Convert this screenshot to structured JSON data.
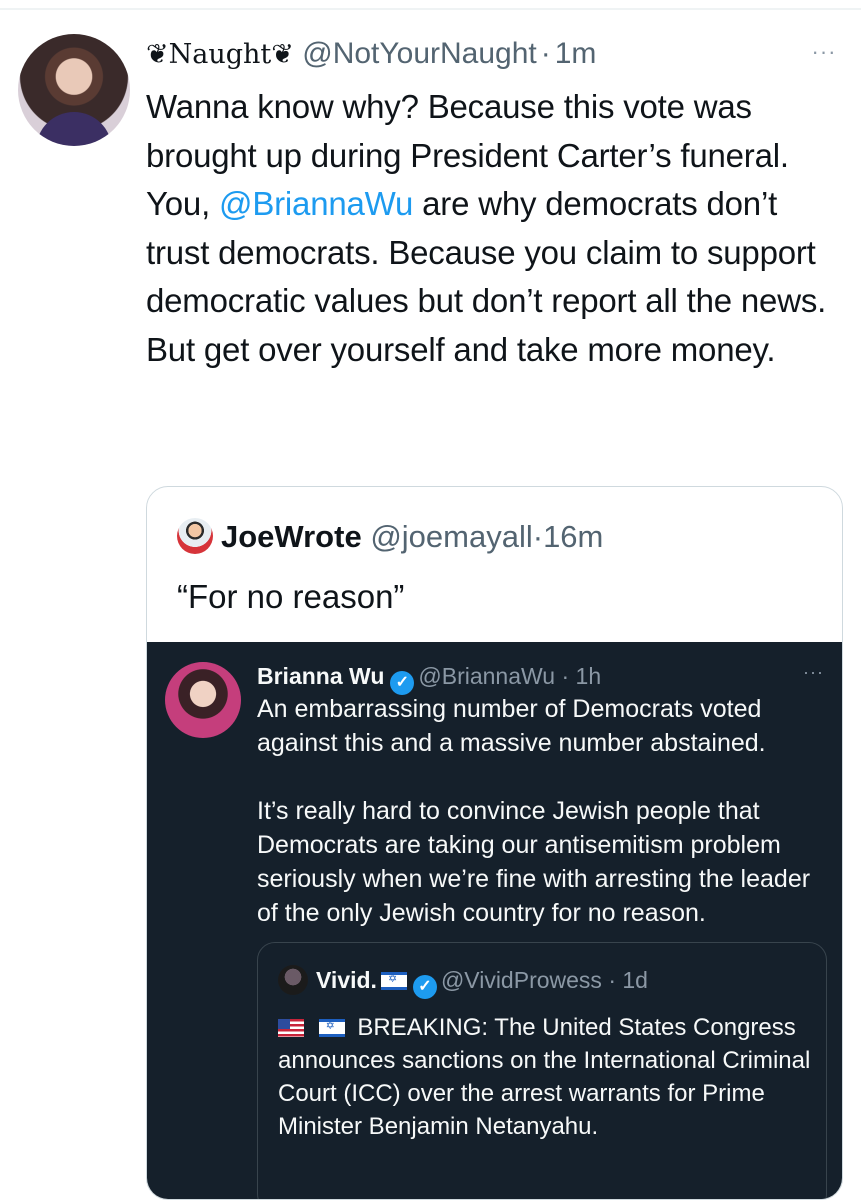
{
  "tweet": {
    "display_name": "❦Naught❦",
    "handle": "@NotYourNaught",
    "separator": "·",
    "time": "1m",
    "more_label": "···",
    "text_before_mention": "Wanna know why? Because this vote was brought up during President Carter’s funeral. You, ",
    "mention": "@BriannaWu",
    "text_after_mention": " are why democrats don’t trust democrats. Because you claim to support democratic values but don’t report all the news. But get over yourself and take more money."
  },
  "quote": {
    "display_name": "JoeWrote",
    "handle": "@joemayall",
    "separator": "·",
    "time": "16m",
    "text": "“For no reason”"
  },
  "screenshot": {
    "display_name": "Brianna Wu",
    "verified_mark": "✓",
    "handle": "@BriannaWu",
    "separator": "·",
    "time": "1h",
    "more_label": "···",
    "paragraph_1": "An embarrassing number of Democrats voted against this and a massive number abstained.",
    "paragraph_2": "It’s really hard to convince Jewish people that Democrats are taking our antisemitism problem seriously when we’re fine with arresting the leader of the only Jewish country for no reason."
  },
  "inner_quote": {
    "display_name": "Vivid.",
    "verified_mark": "✓",
    "handle": "@VividProwess",
    "separator": "·",
    "time": "1d",
    "text": "BREAKING: The United States Congress announces sanctions on the International Criminal Court (ICC) over the arrest warrants for Prime Minister Benjamin Netanyahu."
  },
  "icons": {
    "verified": "verified-badge-icon",
    "more": "more-options-icon",
    "flag_us": "us-flag-icon",
    "flag_il": "israel-flag-icon"
  },
  "colors": {
    "link": "#1d9bf0",
    "dark_bg": "#15202b",
    "verified": "#1d9bf0"
  }
}
